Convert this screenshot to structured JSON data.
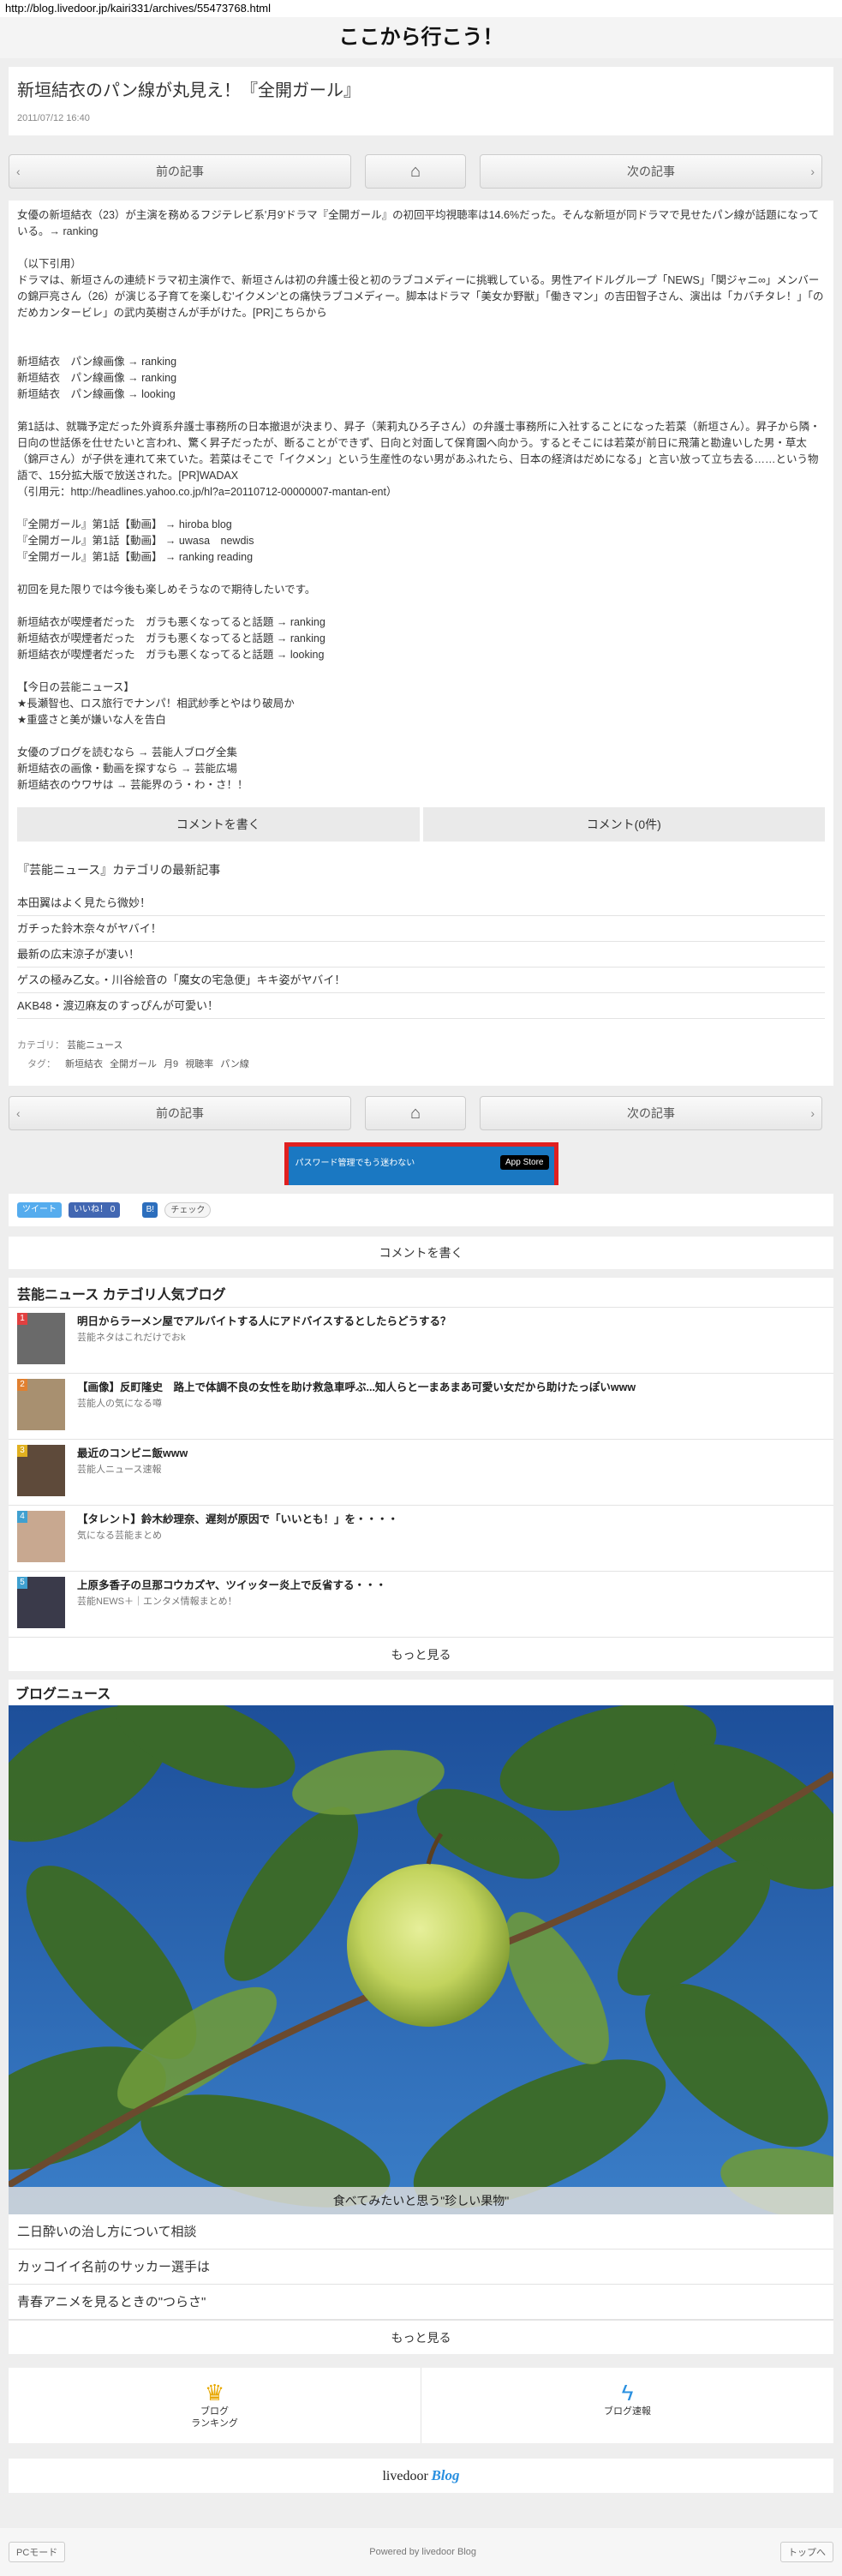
{
  "browser": {
    "url": "http://blog.livedoor.jp/kairi331/archives/55473768.html"
  },
  "site": {
    "title": "ここから行こう！"
  },
  "article": {
    "title": "新垣結衣のパン線が丸見え！『全開ガール』",
    "date": "2011/07/12 16:40",
    "nav": {
      "prev": "前の記事",
      "home_icon": "home-icon",
      "next": "次の記事"
    },
    "lines": [
      "女優の新垣結衣（23）が主演を務めるフジテレビ系'月9'ドラマ『全開ガール』の初回平均視聴率は14.6%だった。そんな新垣が同ドラマで見せたパン線が話題になっている。→ ranking",
      "",
      "（以下引用）",
      "ドラマは、新垣さんの連続ドラマ初主演作で、新垣さんは初の弁護士役と初のラブコメディーに挑戦している。男性アイドルグループ「NEWS」「関ジャニ∞」メンバーの錦戸亮さん（26）が演じる子育てを楽しむ'イクメン'との痛快ラブコメディー。脚本はドラマ「美女か野獣」「働きマン」の吉田智子さん、演出は「カバチタレ！」「のだめカンタービレ」の武内英樹さんが手がけた。[PR]こちらから",
      "",
      "",
      "新垣結衣　パン線画像 → ranking",
      "新垣結衣　パン線画像 → ranking",
      "新垣結衣　パン線画像 → looking",
      "",
      "第1話は、就職予定だった外資系弁護士事務所の日本撤退が決まり、昇子（茉莉丸ひろ子さん）の弁護士事務所に入社することになった若菜（新垣さん）。昇子から隣・日向の世話係を仕せたいと言われ、驚く昇子だったが、断ることができず、日向と対面して保育園へ向かう。するとそこには若菜が前日に飛蒲と勘違いした男・草太（錦戸さん）が子供を連れて来ていた。若菜はそこで「イクメン」という生産性のない男があふれたら、日本の経済はだめになる」と言い放って立ち去る……という物語で、15分拡大版で放送された。[PR]WADAX",
      "（引用元：http://headlines.yahoo.co.jp/hl?a=20110712-00000007-mantan-ent）",
      "",
      "『全開ガール』第1話【動画】 → hiroba blog",
      "『全開ガール』第1話【動画】 → uwasa　newdis",
      "『全開ガール』第1話【動画】 → ranking reading",
      "",
      "初回を見た限りでは今後も楽しめそうなので期待したいです。",
      "",
      "新垣結衣が喫煙者だった　ガラも悪くなってると話題 → ranking",
      "新垣結衣が喫煙者だった　ガラも悪くなってると話題 → ranking",
      "新垣結衣が喫煙者だった　ガラも悪くなってると話題 → looking",
      "",
      "【今日の芸能ニュース】",
      "★長瀬智也、ロス旅行でナンパ！相武紗季とやはり破局か",
      "★重盛さと美が嫌いな人を告白",
      "",
      "女優のブログを読むなら → 芸能人ブログ全集",
      "新垣結衣の画像・動画を探すなら → 芸能広場",
      "新垣結衣のウワサは → 芸能界のう・わ・さ！！"
    ],
    "comment_write": "コメントを書く",
    "comment_count": "コメント(0件)",
    "category_heading": "『芸能ニュース』カテゴリの最新記事",
    "category_items": [
      "本田翼はよく見たら微妙！",
      "ガチった鈴木奈々がヤバイ！",
      "最新の広末涼子が凄い！",
      "ゲスの極み乙女。・川谷絵音の「魔女の宅急便」キキ姿がヤバイ！",
      "AKB48・渡辺麻友のすっぴんが可愛い！"
    ],
    "category_label": "カテゴリ：",
    "category_value": "芸能ニュース",
    "tags_label": "タグ：",
    "tags": [
      "新垣結衣",
      "全開ガール",
      "月9",
      "視聴率",
      "パン線"
    ]
  },
  "ad": {
    "text": "パスワード管理でもう迷わない",
    "store": "App Store"
  },
  "share": {
    "tweet": "ツイート",
    "like": "いいね！ 0",
    "hatena": "B!",
    "check": "チェック"
  },
  "comment_write_2": "コメントを書く",
  "popular": {
    "heading": "芸能ニュース カテゴリ人気ブログ",
    "items": [
      {
        "rank": "1",
        "title": "明日からラーメン屋でアルバイトする人にアドバイスするとしたらどうする？",
        "source": "芸能ネタはこれだけでおk",
        "rank_color": "#e04040"
      },
      {
        "rank": "2",
        "title": "【画像】反町隆史　路上で体調不良の女性を助け救急車呼ぶ...知人らと一まあまあ可愛い女だから助けたっぽいwww",
        "source": "芸能人の気になる噂",
        "rank_color": "#e08030"
      },
      {
        "rank": "3",
        "title": "最近のコンビニ飯www",
        "source": "芸能人ニュース速報",
        "rank_color": "#e0b020"
      },
      {
        "rank": "4",
        "title": "【タレント】鈴木紗理奈、遅刻が原因で「いいとも！」を・・・・",
        "source": "気になる芸能まとめ",
        "rank_color": "#40a0d0"
      },
      {
        "rank": "5",
        "title": "上原多香子の旦那コウカズヤ、ツイッター炎上で反省する・・・",
        "source": "芸能NEWS＋｜エンタメ情報まとめ！",
        "rank_color": "#40a0d0"
      }
    ],
    "more": "もっと見る"
  },
  "blog_news": {
    "heading": "ブログニュース",
    "hero_caption": "食べてみたいと思う\"珍しい果物\"",
    "items": [
      "二日酔いの治し方について相談",
      "カッコイイ名前のサッカー選手は",
      "青春アニメを見るときの\"つらさ\""
    ],
    "more": "もっと見る"
  },
  "bottom_links": {
    "ranking_line1": "ブログ",
    "ranking_line2": "ランキング",
    "breaking": "ブログ速報"
  },
  "logo": {
    "left": "livedoor",
    "right": "Blog"
  },
  "footer": {
    "pc_mode": "PCモード",
    "powered": "Powered by livedoor Blog",
    "top": "トップへ"
  }
}
